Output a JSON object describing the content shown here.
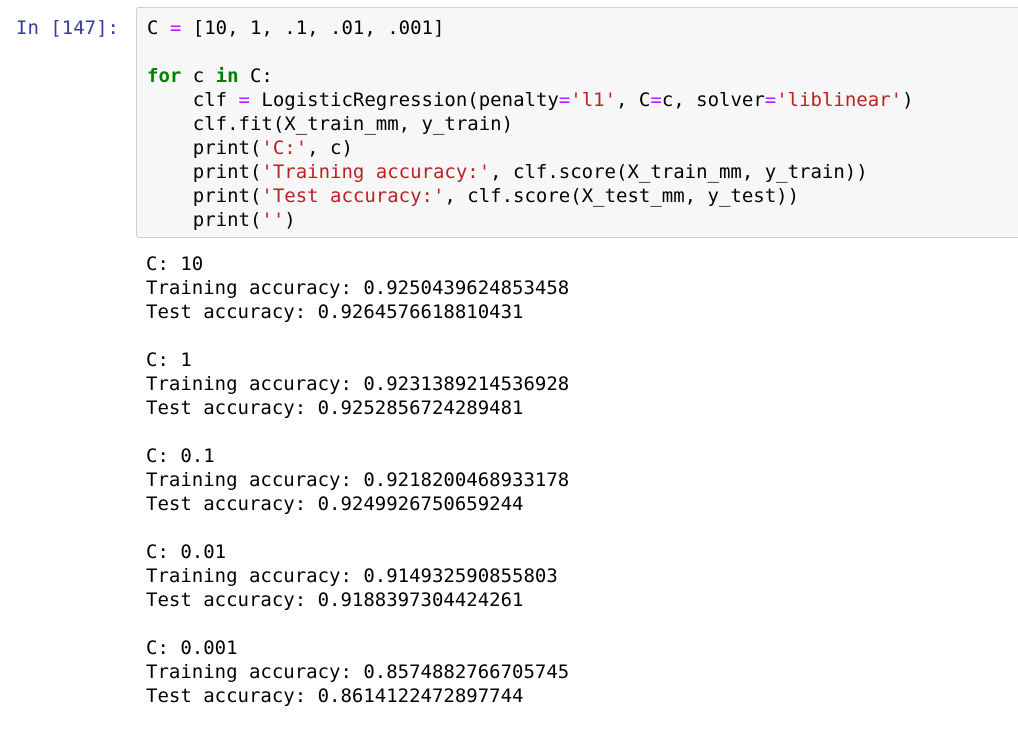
{
  "cell": {
    "prompt": "In [147]:",
    "code": {
      "line1": {
        "a": "C ",
        "eq": "=",
        "b": " [10, 1, .1, .01, .001]"
      },
      "line3": {
        "kw_for": "for",
        "a": " c ",
        "kw_in": "in",
        "b": " C:"
      },
      "line4": {
        "a": "    clf ",
        "eq": "=",
        "b": " LogisticRegression(penalty",
        "eq2": "=",
        "s1": "'l1'",
        "c": ", C",
        "eq3": "=",
        "d": "c, solver",
        "eq4": "=",
        "s2": "'liblinear'",
        "e": ")"
      },
      "line5": {
        "a": "    clf.fit(X_train_mm, y_train)"
      },
      "line6": {
        "a": "    print(",
        "s1": "'C:'",
        "b": ", c)"
      },
      "line7": {
        "a": "    print(",
        "s1": "'Training accuracy:'",
        "b": ", clf.score(X_train_mm, y_train))"
      },
      "line8": {
        "a": "    print(",
        "s1": "'Test accuracy:'",
        "b": ", clf.score(X_test_mm, y_test))"
      },
      "line9": {
        "a": "    print(",
        "s1": "''",
        "b": ")"
      }
    }
  },
  "output": {
    "blocks": [
      {
        "c": "C: 10",
        "train": "Training accuracy: 0.9250439624853458",
        "test": "Test accuracy: 0.9264576618810431"
      },
      {
        "c": "C: 1",
        "train": "Training accuracy: 0.9231389214536928",
        "test": "Test accuracy: 0.9252856724289481"
      },
      {
        "c": "C: 0.1",
        "train": "Training accuracy: 0.9218200468933178",
        "test": "Test accuracy: 0.9249926750659244"
      },
      {
        "c": "C: 0.01",
        "train": "Training accuracy: 0.914932590855803",
        "test": "Test accuracy: 0.9188397304424261"
      },
      {
        "c": "C: 0.001",
        "train": "Training accuracy: 0.8574882766705745",
        "test": "Test accuracy: 0.8614122472897744"
      }
    ]
  },
  "colors": {
    "prompt": "#303f9f",
    "input_background": "#f7f7f7",
    "input_border": "#cfcfcf",
    "keyword": "#008000",
    "string": "#ba2121",
    "operator": "#aa22ff"
  }
}
